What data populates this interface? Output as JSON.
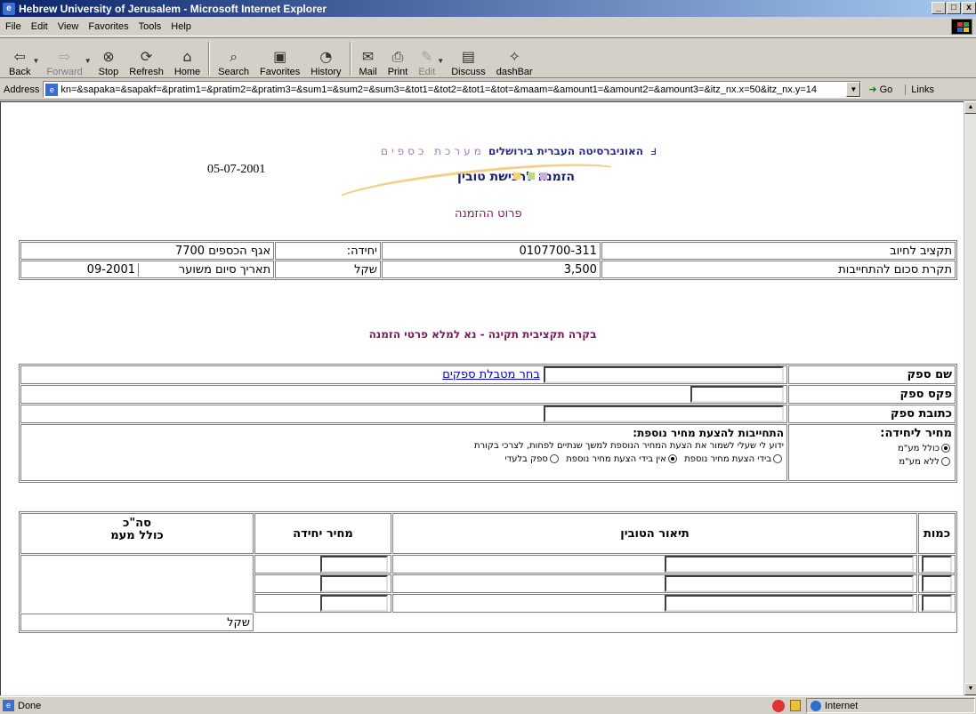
{
  "window": {
    "title": "Hebrew University of Jerusalem - Microsoft Internet Explorer",
    "controls": [
      "_",
      "□",
      "x"
    ]
  },
  "menu": [
    "File",
    "Edit",
    "View",
    "Favorites",
    "Tools",
    "Help"
  ],
  "toolbar": {
    "back": "Back",
    "forward": "Forward",
    "stop": "Stop",
    "refresh": "Refresh",
    "home": "Home",
    "search": "Search",
    "favorites": "Favorites",
    "history": "History",
    "mail": "Mail",
    "print": "Print",
    "edit": "Edit",
    "discuss": "Discuss",
    "dashbar": "dashBar"
  },
  "address": {
    "label": "Address",
    "value": "kn=&sapaka=&sapakf=&pratim1=&pratim2=&pratim3=&sum1=&sum2=&sum3=&tot1=&tot2=&tot1=&tot=&maam=&amount1=&amount2=&amount3=&itz_nx.x=50&itz_nx.y=14",
    "go": "Go",
    "links": "Links"
  },
  "page": {
    "date": "05-07-2001",
    "logo_university": "האוניברסיטה העברית בירושלים",
    "logo_department": "מערכת כספים",
    "logo_subtitle": "הזמנה לרכישת טובין",
    "subtitle": "פרוט ההזמנה",
    "budget": {
      "row1": {
        "label": "תקציב לחיוב",
        "code": "0107700-311",
        "unit_label": "יחידה:",
        "unit_value": "7700 אגף הכספים"
      },
      "row2": {
        "label": "תקרת סכום להתחייבות",
        "amount": "3,500",
        "currency": "שקל",
        "end_date_label": "תאריך סיום משוער",
        "end_date": "09-2001"
      }
    },
    "message": "בקרה תקציבית תקינה - נא למלא פרטי הזמנה",
    "supplier": {
      "name_label": "שם ספק",
      "choose_link": "בחר מטבלת ספקים",
      "fax_label": "פקס ספק",
      "address_label": "כתובת ספק",
      "unit_price_label": "מחיר ליחידה:",
      "vat_incl": "כולל מע\"מ",
      "vat_excl": "ללא מע\"מ",
      "commitment_title": "התחייבות להצעת מחיר נוספת:",
      "commitment_text": "ידוע לי שעלי לשמור את הצעת המחיר הנוספת למשך שנתיים לפחות, לצרכי בקורת",
      "opt_have": "בידי הצעת מחיר נוספת",
      "opt_dont_have": "אין בידי הצעת מחיר נוספת",
      "opt_exclusive": "ספק בלעדי"
    },
    "items": {
      "qty_header": "כמות",
      "desc_header": "תיאור הטובין",
      "price_header": "מחיר יחידה",
      "total_header_1": "סה\"כ",
      "total_header_2": "כולל מעמ",
      "currency": "שקל"
    }
  },
  "status": {
    "text": "Done",
    "zone": "Internet"
  }
}
